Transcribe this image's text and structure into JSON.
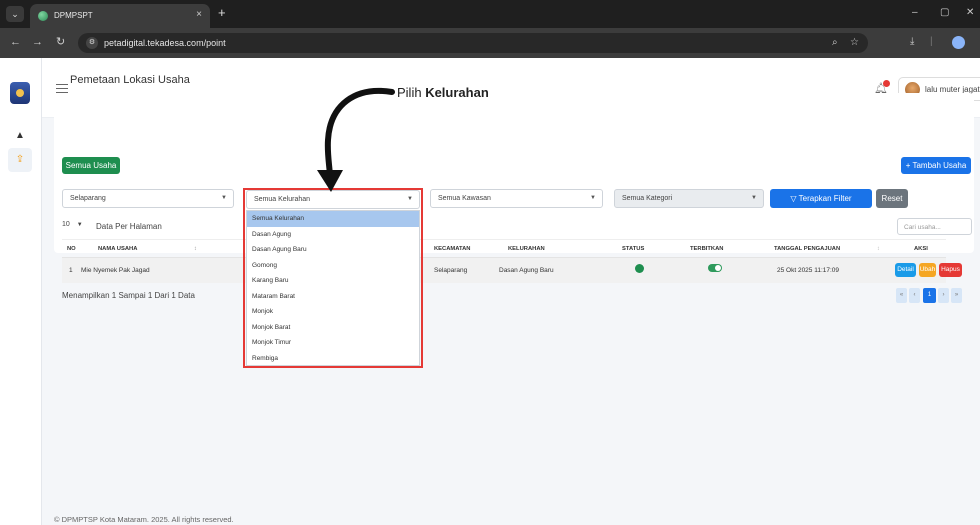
{
  "browser": {
    "tab_title": "DPMPSPT",
    "tab_close": "×",
    "new_tab": "+",
    "url": "petadigital.tekadesa.com/point",
    "window": {
      "minimize": "–",
      "maximize": "▢",
      "close": "✕"
    }
  },
  "header": {
    "user_name": "lalu muter jagat"
  },
  "page": {
    "title": "Pemetaan Lokasi Usaha",
    "all_businesses_button": "Semua Usaha",
    "add_business_button": "+ Tambah Usaha"
  },
  "filters": {
    "kecamatan": "Selaparang",
    "kelurahan": "Semua Kelurahan",
    "kawasan": "Semua Kawasan",
    "kategori": "Semua Kategori",
    "apply_button": "▽ Terapkan Filter",
    "reset_button": "Reset",
    "kelurahan_options": [
      "Semua Kelurahan",
      "Dasan Agung",
      "Dasan Agung Baru",
      "Gomong",
      "Karang Baru",
      "Mataram Barat",
      "Monjok",
      "Monjok Barat",
      "Monjok Timur",
      "Rembiga"
    ],
    "selected_option": "Semua Kelurahan"
  },
  "table_controls": {
    "per_page": "10",
    "per_page_label": "Data Per Halaman",
    "search_placeholder": "Cari usaha..."
  },
  "table": {
    "headers": [
      "NO",
      "NAMA USAHA",
      "KECAMATAN",
      "KELURAHAN",
      "STATUS",
      "TERBITKAN",
      "TANGGAL PENGAJUAN",
      "AKSI"
    ],
    "rows": [
      {
        "no": "1",
        "nama_usaha": "Mie Nyemek Pak Jagad",
        "kecamatan": "Selaparang",
        "kelurahan": "Dasan Agung Baru",
        "status": "active",
        "terbitkan": "on",
        "tanggal": "25 Okt 2025 11:17:09",
        "actions": [
          "Detail",
          "Ubah",
          "Hapus"
        ]
      }
    ]
  },
  "pagination": {
    "summary": "Menampilkan 1 Sampai 1 Dari 1 Data",
    "current_page": "1",
    "first": "«",
    "prev": "‹",
    "next": "›",
    "last": "»"
  },
  "footer": {
    "text": "© DPMPTSP Kota Mataram. 2025. All rights reserved."
  },
  "annotation": {
    "prefix": "Pilih ",
    "bold": "Kelurahan"
  },
  "colors": {
    "primary": "#1a73e8",
    "success": "#1e8e4f",
    "warning": "#f5a623",
    "danger": "#e53935",
    "highlight_frame": "#e53935"
  },
  "icons": [
    "menu-icon",
    "bell-icon",
    "home-icon",
    "upload-icon",
    "chevron-down-icon",
    "filter-icon",
    "search-icon"
  ]
}
